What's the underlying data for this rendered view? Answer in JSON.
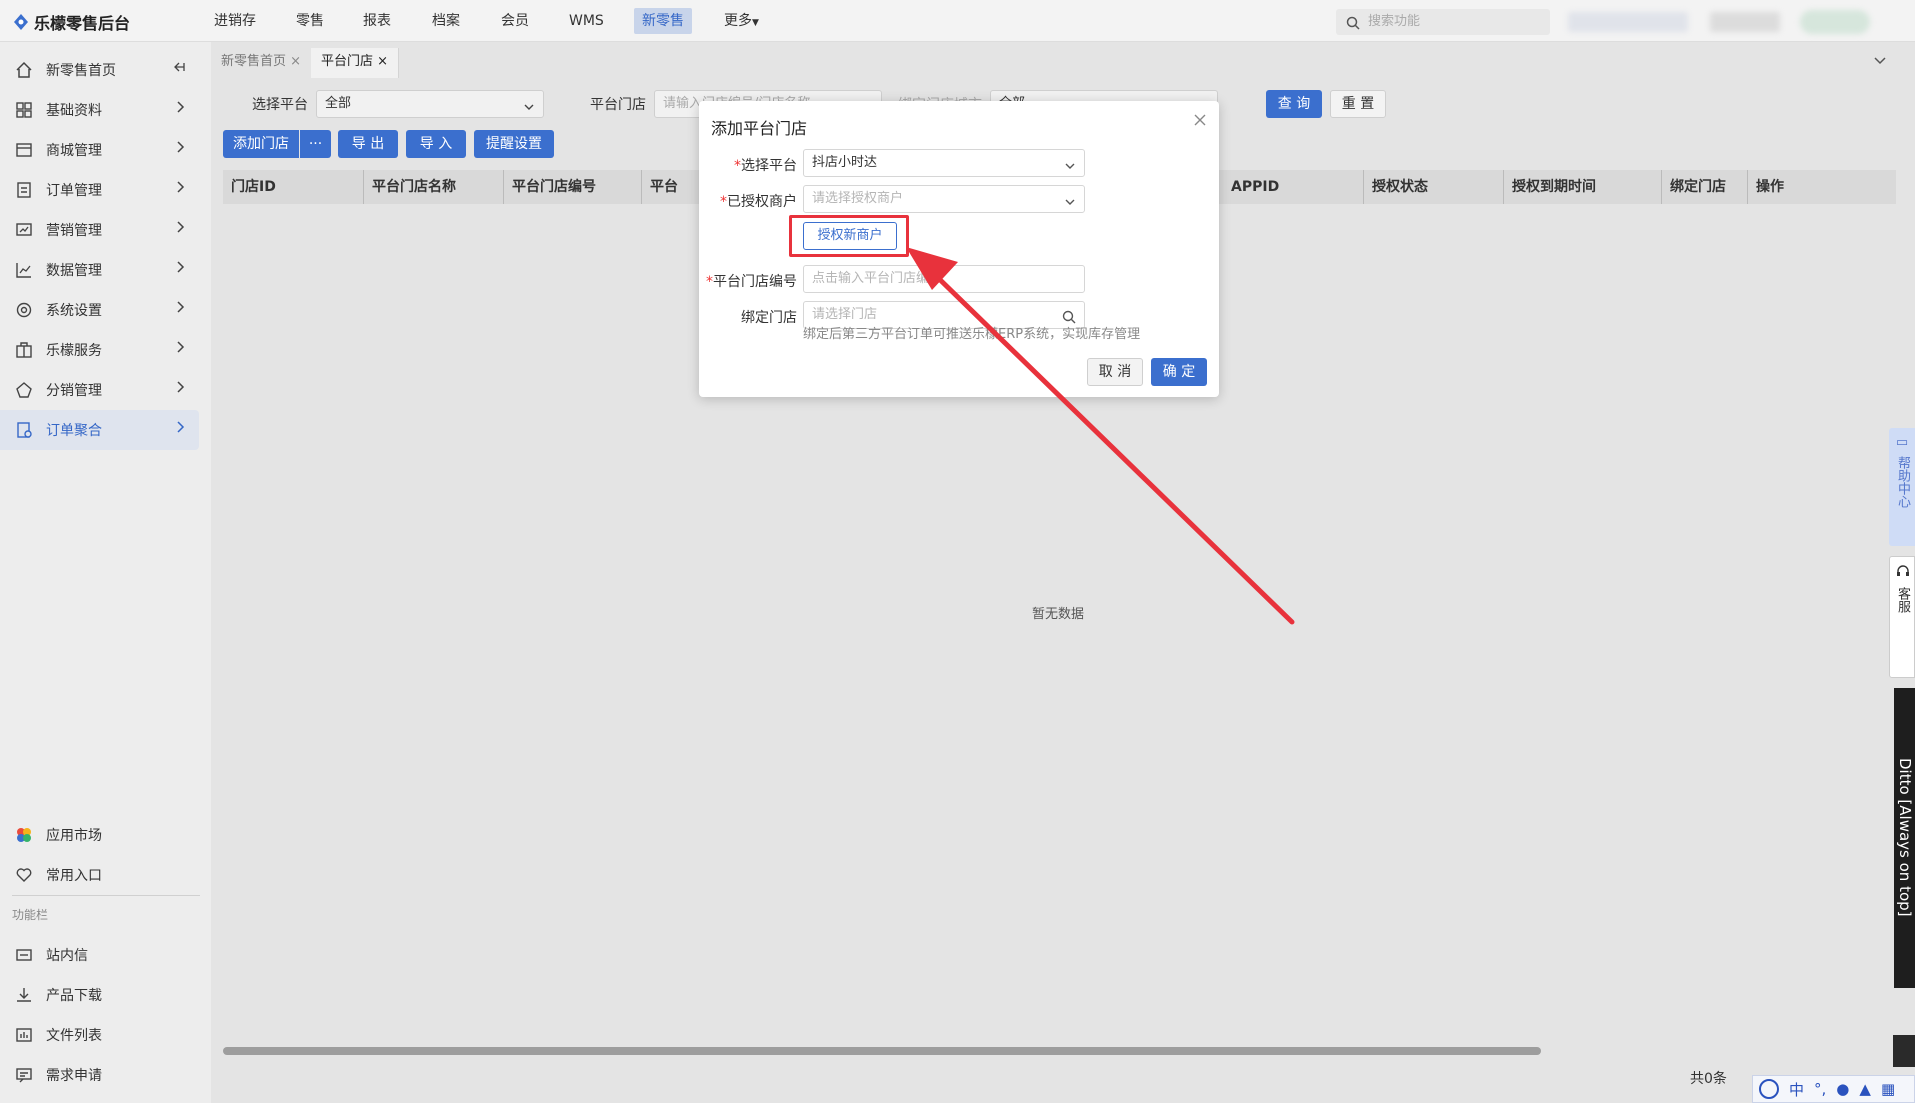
{
  "app": {
    "name": "乐檬零售后台"
  },
  "topnav": {
    "items": [
      "进销存",
      "零售",
      "报表",
      "档案",
      "会员",
      "WMS",
      "新零售",
      "更多"
    ],
    "active": "新零售",
    "search_placeholder": "搜索功能"
  },
  "sidebar": {
    "items": [
      {
        "label": "新零售首页",
        "icon": "home-icon"
      },
      {
        "label": "基础资料",
        "icon": "grid-icon"
      },
      {
        "label": "商城管理",
        "icon": "shop-icon"
      },
      {
        "label": "订单管理",
        "icon": "order-icon"
      },
      {
        "label": "营销管理",
        "icon": "marketing-icon"
      },
      {
        "label": "数据管理",
        "icon": "chart-icon"
      },
      {
        "label": "系统设置",
        "icon": "settings-icon"
      },
      {
        "label": "乐檬服务",
        "icon": "service-icon"
      },
      {
        "label": "分销管理",
        "icon": "distribution-icon"
      },
      {
        "label": "订单聚合",
        "icon": "aggregate-icon"
      }
    ],
    "active": "订单聚合",
    "bottom_items": [
      {
        "label": "应用市场",
        "icon": "app-market-icon"
      },
      {
        "label": "常用入口",
        "icon": "heart-icon"
      }
    ],
    "section_label": "功能栏",
    "function_items": [
      {
        "label": "站内信",
        "icon": "mail-icon"
      },
      {
        "label": "产品下载",
        "icon": "download-icon"
      },
      {
        "label": "文件列表",
        "icon": "file-list-icon"
      },
      {
        "label": "需求申请",
        "icon": "request-icon"
      }
    ]
  },
  "tabs": [
    {
      "label": "新零售首页",
      "close": "×"
    },
    {
      "label": "平台门店",
      "close": "×"
    }
  ],
  "filters": {
    "platform_label": "选择平台",
    "platform_value": "全部",
    "store_label": "平台门店",
    "store_placeholder": "请输入门店编号/门店名称",
    "bind_label": "绑定门店城市",
    "bind_value": "全部",
    "query_btn": "查 询",
    "reset_btn": "重 置"
  },
  "toolbar": {
    "add_btn": "添加门店",
    "more_btn": "···",
    "export_btn": "导 出",
    "import_btn": "导 入",
    "remind_btn": "提醒设置"
  },
  "table": {
    "columns": [
      "门店ID",
      "平台门店名称",
      "平台门店编号",
      "平台",
      "APPID",
      "授权状态",
      "授权到期时间",
      "绑定门店",
      "操作"
    ],
    "empty_text": "暂无数据",
    "total_text": "共0条"
  },
  "modal": {
    "title": "添加平台门店",
    "close": "×",
    "platform_label": "选择平台",
    "platform_value": "抖店小时达",
    "merchant_label": "已授权商户",
    "merchant_placeholder": "请选择授权商户",
    "auth_btn": "授权新商户",
    "store_no_label": "平台门店编号",
    "store_no_placeholder": "点击输入平台门店编号",
    "bind_store_label": "绑定门店",
    "bind_store_placeholder": "请选择门店",
    "hint": "绑定后第三方平台订单可推送乐檬ERP系统，实现库存管理",
    "cancel_btn": "取 消",
    "ok_btn": "确 定",
    "required_mark": "*"
  },
  "right_widgets": {
    "help": "帮助中心",
    "service": "客服",
    "ditto": "Ditto [Always on top]"
  },
  "ime": {
    "lang": "中"
  },
  "colors": {
    "accent": "#3b6fce",
    "annotation": "#e8323c"
  }
}
